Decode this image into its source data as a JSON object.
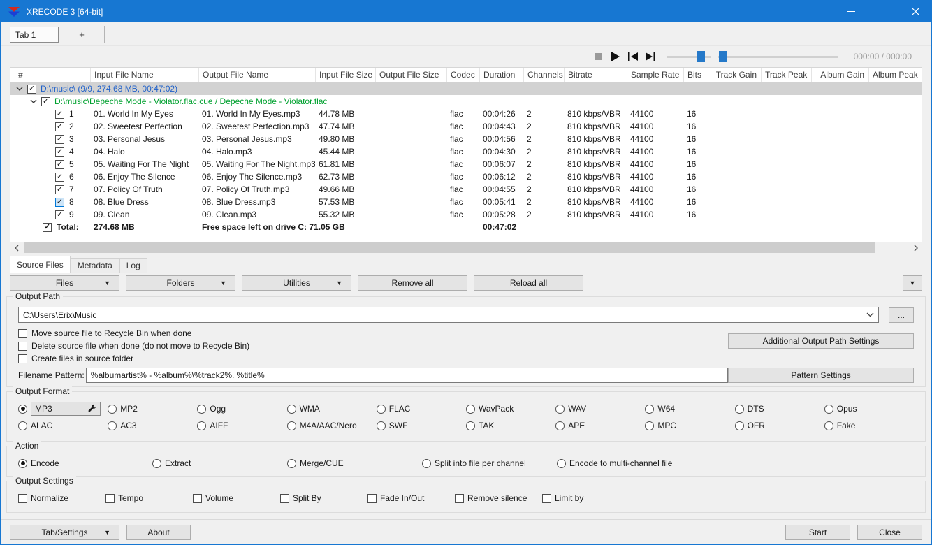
{
  "window": {
    "title": "XRECODE 3 [64-bit]"
  },
  "icons": {
    "dropdown": "▼",
    "check": "✓",
    "plus": "+",
    "ellipsis": "..."
  },
  "top_tabs": {
    "tab1": "Tab 1"
  },
  "player": {
    "time": "000:00 / 000:00"
  },
  "table": {
    "columns": [
      "#",
      "Input File Name",
      "Output File Name",
      "Input File Size",
      "Output File Size",
      "Codec",
      "Duration",
      "Channels",
      "Bitrate",
      "Sample Rate",
      "Bits",
      "Track Gain",
      "Track Peak",
      "Album Gain",
      "Album Peak"
    ],
    "group_row": "D:\\music\\ (9/9, 274.68 MB, 00:47:02)",
    "album_row": "D:\\music\\Depeche Mode - Violator.flac.cue / Depeche Mode - Violator.flac",
    "rows": [
      {
        "num": "1",
        "input": "01. World In My Eyes",
        "output": "01. World In My Eyes.mp3",
        "in_size": "44.78 MB",
        "codec": "flac",
        "duration": "00:04:26",
        "channels": "2",
        "bitrate": "810 kbps/VBR",
        "sample_rate": "44100",
        "bits": "16"
      },
      {
        "num": "2",
        "input": "02. Sweetest Perfection",
        "output": "02. Sweetest Perfection.mp3",
        "in_size": "47.74 MB",
        "codec": "flac",
        "duration": "00:04:43",
        "channels": "2",
        "bitrate": "810 kbps/VBR",
        "sample_rate": "44100",
        "bits": "16"
      },
      {
        "num": "3",
        "input": "03. Personal Jesus",
        "output": "03. Personal Jesus.mp3",
        "in_size": "49.80 MB",
        "codec": "flac",
        "duration": "00:04:56",
        "channels": "2",
        "bitrate": "810 kbps/VBR",
        "sample_rate": "44100",
        "bits": "16"
      },
      {
        "num": "4",
        "input": "04. Halo",
        "output": "04. Halo.mp3",
        "in_size": "45.44 MB",
        "codec": "flac",
        "duration": "00:04:30",
        "channels": "2",
        "bitrate": "810 kbps/VBR",
        "sample_rate": "44100",
        "bits": "16"
      },
      {
        "num": "5",
        "input": "05. Waiting For The Night",
        "output": "05. Waiting For The Night.mp3",
        "in_size": "61.81 MB",
        "codec": "flac",
        "duration": "00:06:07",
        "channels": "2",
        "bitrate": "810 kbps/VBR",
        "sample_rate": "44100",
        "bits": "16"
      },
      {
        "num": "6",
        "input": "06. Enjoy The Silence",
        "output": "06. Enjoy The Silence.mp3",
        "in_size": "62.73 MB",
        "codec": "flac",
        "duration": "00:06:12",
        "channels": "2",
        "bitrate": "810 kbps/VBR",
        "sample_rate": "44100",
        "bits": "16"
      },
      {
        "num": "7",
        "input": "07. Policy Of Truth",
        "output": "07. Policy Of Truth.mp3",
        "in_size": "49.66 MB",
        "codec": "flac",
        "duration": "00:04:55",
        "channels": "2",
        "bitrate": "810 kbps/VBR",
        "sample_rate": "44100",
        "bits": "16"
      },
      {
        "num": "8",
        "input": "08. Blue Dress",
        "output": "08. Blue Dress.mp3",
        "in_size": "57.53 MB",
        "codec": "flac",
        "duration": "00:05:41",
        "channels": "2",
        "bitrate": "810 kbps/VBR",
        "sample_rate": "44100",
        "bits": "16",
        "hot": true
      },
      {
        "num": "9",
        "input": "09. Clean",
        "output": "09. Clean.mp3",
        "in_size": "55.32 MB",
        "codec": "flac",
        "duration": "00:05:28",
        "channels": "2",
        "bitrate": "810 kbps/VBR",
        "sample_rate": "44100",
        "bits": "16"
      }
    ],
    "total": {
      "label": "Total:",
      "size": "274.68 MB",
      "free_space": "Free space left on drive C: 71.05 GB",
      "duration": "00:47:02"
    }
  },
  "source_tabs": [
    "Source Files",
    "Metadata",
    "Log"
  ],
  "toolbar": {
    "files": "Files",
    "folders": "Folders",
    "utilities": "Utilities",
    "remove_all": "Remove all",
    "reload_all": "Reload all"
  },
  "output_path": {
    "label": "Output Path",
    "path": "C:\\Users\\Erix\\Music",
    "browse": "...",
    "checkboxes": [
      "Move source file to Recycle Bin when done",
      "Delete source file when done (do not move to Recycle Bin)",
      "Create files in source folder"
    ],
    "additional_button": "Additional Output Path Settings",
    "pattern_label": "Filename Pattern:",
    "pattern_value": "%albumartist% - %album%\\%track2%. %title%",
    "pattern_button": "Pattern Settings"
  },
  "output_format": {
    "label": "Output Format",
    "selected": "MP3",
    "row1": [
      "MP3",
      "MP2",
      "Ogg",
      "WMA",
      "FLAC",
      "WavPack",
      "WAV",
      "W64",
      "DTS",
      "Opus"
    ],
    "row2": [
      "ALAC",
      "AC3",
      "AIFF",
      "M4A/AAC/Nero",
      "SWF",
      "TAK",
      "APE",
      "MPC",
      "OFR",
      "Fake"
    ]
  },
  "action": {
    "label": "Action",
    "selected": "Encode",
    "options": [
      "Encode",
      "Extract",
      "Merge/CUE",
      "Split into file per channel",
      "Encode to multi-channel file"
    ]
  },
  "output_settings": {
    "label": "Output Settings",
    "options": [
      "Normalize",
      "Tempo",
      "Volume",
      "Split By",
      "Fade In/Out",
      "Remove silence",
      "Limit by"
    ]
  },
  "footer": {
    "tab_settings": "Tab/Settings",
    "about": "About",
    "start": "Start",
    "close": "Close"
  }
}
